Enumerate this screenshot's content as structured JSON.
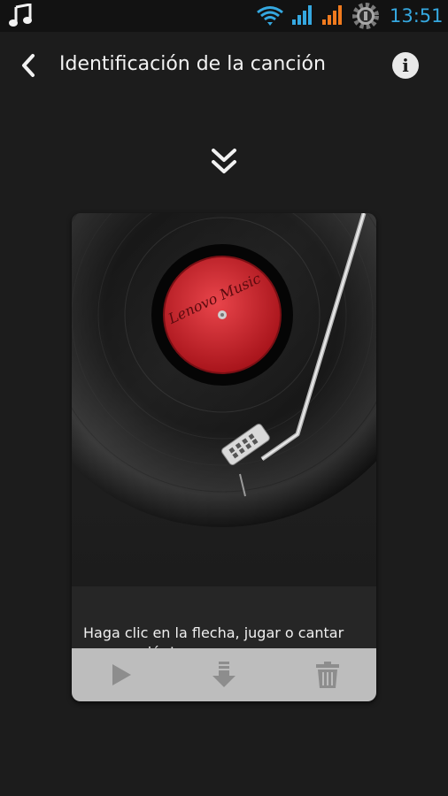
{
  "status_bar": {
    "time": "13:51",
    "icons": [
      "music-note-icon",
      "wifi-icon",
      "signal-1-icon",
      "signal-2-icon",
      "settings-gear-icon"
    ],
    "time_color": "#35a8e0"
  },
  "header": {
    "title": "Identificación de la canción",
    "back_icon": "chevron-left-icon",
    "info_label": "i"
  },
  "record": {
    "label_text": "Lenovo Music",
    "label_color": "#d8232a"
  },
  "card": {
    "caption": "Haga clic en la flecha, jugar o cantar una canción!"
  },
  "controls": {
    "icons": [
      "play-icon",
      "download-icon",
      "trash-icon"
    ]
  }
}
